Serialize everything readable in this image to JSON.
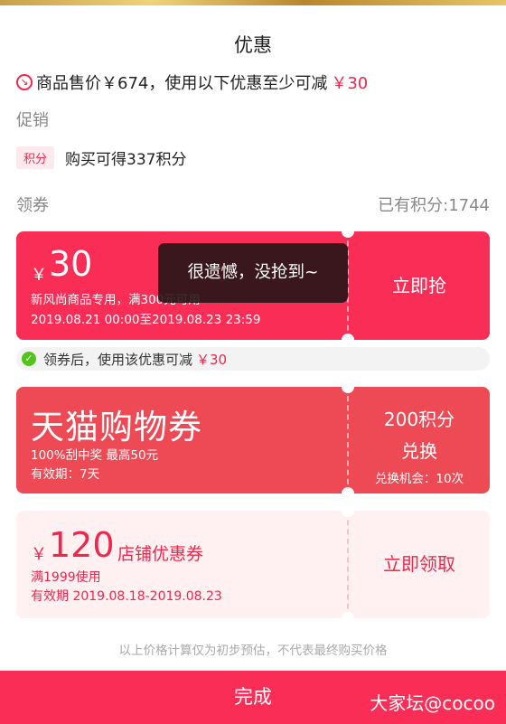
{
  "header": {
    "title": "优惠"
  },
  "sale_info": {
    "prefix": "商品售价￥674，使用以下优惠至少可减",
    "amount": "￥30"
  },
  "promotion": {
    "section": "促销",
    "tag": "积分",
    "text": "购买可得337积分"
  },
  "coupons_section": {
    "title": "领券",
    "points_owned": "已有积分:1744"
  },
  "coupon1": {
    "currency": "￥",
    "amount": "30",
    "desc": "新风尚商品专用，满300元可用",
    "validity": "2019.08.21 00:00至2019.08.23 23:59",
    "action": "立即抢"
  },
  "toast": "很遗憾，没抢到~",
  "tip": {
    "prefix": "领券后，使用该优惠可减",
    "amount": "￥30"
  },
  "coupon2": {
    "title": "天猫购物券",
    "line2": "100%刮中奖 最高50元",
    "line3": "有效期：7天",
    "points": "200积分",
    "exchange": "兑换",
    "chance": "兑换机会：10次"
  },
  "coupon3": {
    "currency": "￥",
    "amount": "120",
    "type": "店铺优惠券",
    "condition": "满1999使用",
    "validity": "有效期 2019.08.18-2019.08.23",
    "action": "立即领取"
  },
  "footnote": "以上价格计算仅为初步预估，不代表最终购买价格",
  "bottom": {
    "done": "完成",
    "watermark": "大家坛@cocoo"
  },
  "colors": {
    "accent": "#fa2d56",
    "coupon2": "#ee4a55",
    "coupon3_bg": "#fff1f1",
    "check": "#52c41a"
  }
}
